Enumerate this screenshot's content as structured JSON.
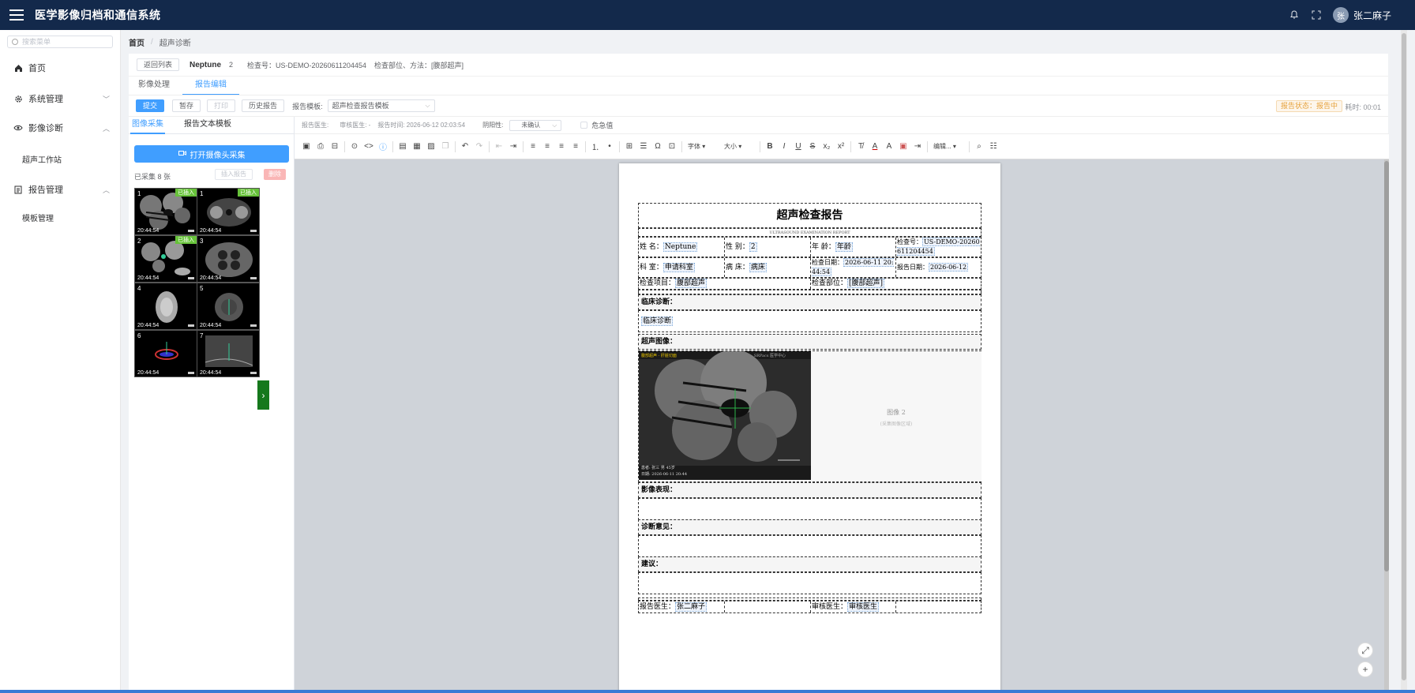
{
  "app": {
    "title": "医学影像归档和通信系统",
    "user": "张二麻子",
    "avatar_text": "张"
  },
  "sidebar": {
    "search_placeholder": "搜索菜单",
    "items": [
      {
        "label": "首页",
        "icon": "home-icon"
      },
      {
        "label": "系统管理",
        "icon": "gear-icon"
      },
      {
        "label": "影像诊断",
        "icon": "eye-icon"
      },
      {
        "label": "超声工作站"
      },
      {
        "label": "报告管理",
        "icon": "document-icon"
      },
      {
        "label": "模板管理"
      }
    ]
  },
  "breadcrumb": {
    "home": "首页",
    "current": "超声诊断"
  },
  "patient": {
    "back": "返回列表",
    "name": "Neptune",
    "num": "2",
    "exam_no": "检查号：US-DEMO-20260611204454",
    "exam_part": "检查部位、方法：[腹部超声]"
  },
  "tabs": [
    "影像处理",
    "报告编辑"
  ],
  "toolbar": {
    "submit": "提交",
    "save": "暂存",
    "print": "打印",
    "history": "历史报告",
    "template_label": "报告模板:",
    "template_value": "超声检查报告模板",
    "status": "报告状态：报告中",
    "elapsed": "耗时: 00:01"
  },
  "capture": {
    "tabs": [
      "图像采集",
      "报告文本模板"
    ],
    "camera_btn": "打开摄像头采集",
    "count": "已采集 8 张",
    "insert": "插入报告",
    "delete": "删除",
    "thumbs": [
      {
        "n": "1",
        "t": "20:44:54",
        "tag": "已插入"
      },
      {
        "n": "1",
        "t": "20:44:54",
        "tag": "已插入"
      },
      {
        "n": "2",
        "t": "20:44:54",
        "tag": "已插入"
      },
      {
        "n": "3",
        "t": "20:44:54",
        "tag": ""
      },
      {
        "n": "4",
        "t": "20:44:54",
        "tag": ""
      },
      {
        "n": "5",
        "t": "20:44:54",
        "tag": ""
      },
      {
        "n": "6",
        "t": "20:44:54",
        "tag": ""
      },
      {
        "n": "7",
        "t": "20:44:54",
        "tag": ""
      }
    ]
  },
  "meta": {
    "doctor": "报告医生:",
    "reviewer": "审核医生: -",
    "time": "报告时间: 2026-06-12 02:03:54",
    "yin_label": "阴阳性:",
    "yin_value": "未确认",
    "urgent": "危急值"
  },
  "editor_tools": {
    "font": "字体",
    "size": "大小",
    "edit": "编辑..."
  },
  "report": {
    "title": "超声检查报告",
    "subtitle": "ULTRASOUND EXAMINATION REPORT",
    "name_label": "姓 名：",
    "name": "Neptune",
    "sex_label": "性 别：",
    "sex": "2",
    "age_label": "年 龄：",
    "age": "年龄",
    "examno_label": "检查号：",
    "examno": "US-DEMO-20260611204454",
    "dept_label": "科 室：",
    "dept": "申请科室",
    "bed_label": "病 床：",
    "bed": "病床",
    "examdate_label": "检查日期：",
    "examdate": "2026-06-11 20:44:54",
    "rptdate_label": "报告日期：",
    "rptdate": "2026-06-12",
    "item_label": "检查项目：",
    "item": "腹部超声",
    "part_label": "检查部位：",
    "part": "[腹部超声]",
    "clinical_label": "临床诊断：",
    "clinical": "临床诊断",
    "image_label": "超声图像：",
    "img_top_left": "腹部超声 - 肝脏切面",
    "img_top_right": "SRPacs 医学中心",
    "img_bottom1": "患者: 张三 男 45岁",
    "img_bottom2": "日期: 2026-06-11 20:44",
    "img2_label": "图像 2",
    "img2_hint": "(采集图像区域)",
    "findings_label": "影像表现：",
    "opinion_label": "诊断意见：",
    "advice_label": "建议：",
    "doc_label": "报告医生：",
    "doc": "张二麻子",
    "rev_label": "审核医生：",
    "rev": "审核医生"
  }
}
